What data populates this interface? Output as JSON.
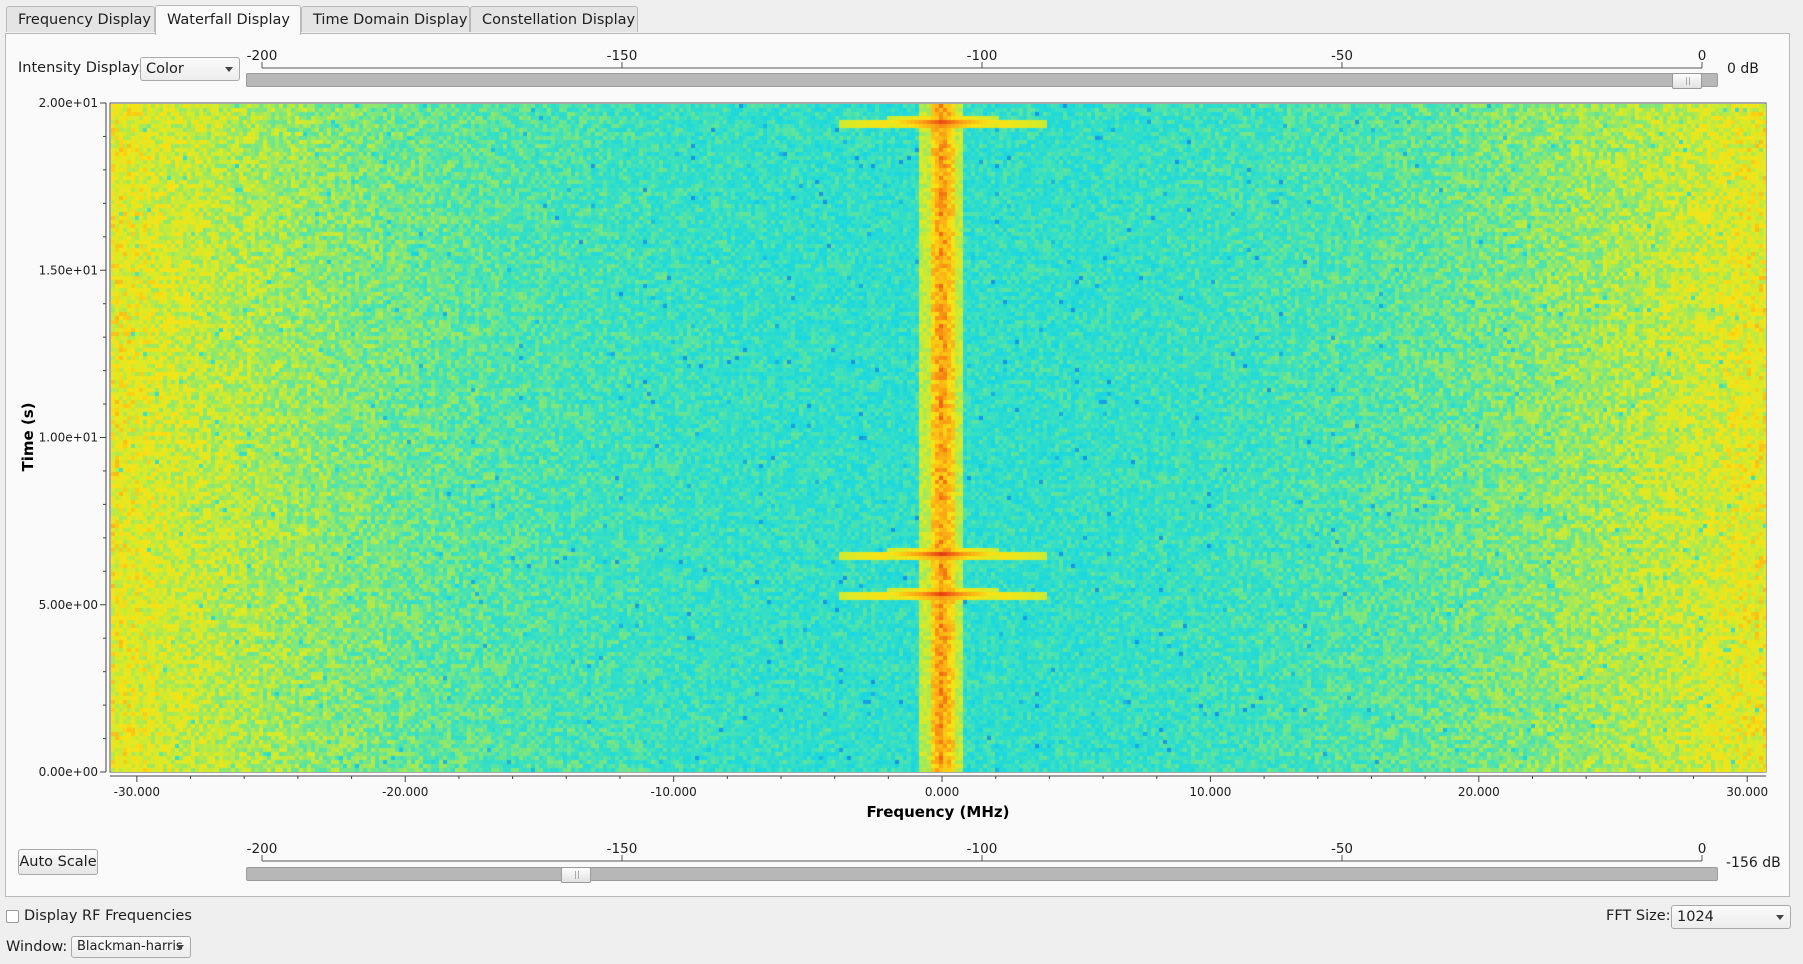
{
  "tabs": [
    {
      "label": "Frequency Display"
    },
    {
      "label": "Waterfall Display"
    },
    {
      "label": "Time Domain Display"
    },
    {
      "label": "Constellation Display"
    }
  ],
  "active_tab": "Waterfall Display",
  "intensity": {
    "label": "Intensity Display:",
    "value": "Color"
  },
  "top_slider": {
    "ticks": [
      "-200",
      "-150",
      "-100",
      "-50",
      "0"
    ],
    "value_label": "0 dB",
    "value_db": 0,
    "range": [
      -200,
      0
    ]
  },
  "bottom_slider": {
    "ticks": [
      "-200",
      "-150",
      "-100",
      "-50",
      "0"
    ],
    "value_label": "-156 dB",
    "value_db": -156,
    "range": [
      -200,
      0
    ]
  },
  "auto_scale_label": "Auto Scale",
  "display_rf": {
    "label": "Display RF Frequencies",
    "checked": false
  },
  "fft": {
    "label": "FFT Size:",
    "value": "1024"
  },
  "window": {
    "label": "Window:",
    "value": "Blackman-harris"
  },
  "colors": {
    "accent_low": "#1ad8e0",
    "accent_high": "#f5e31c",
    "signal": "#e8241a"
  },
  "chart_data": {
    "type": "heatmap",
    "xlabel": "Frequency (MHz)",
    "ylabel": "Time (s)",
    "x_ticks": [
      "-30.000",
      "-20.000",
      "-10.000",
      "0.000",
      "10.000",
      "20.000",
      "30.000"
    ],
    "x_tick_values": [
      -30,
      -20,
      -10,
      0,
      10,
      20,
      30
    ],
    "y_ticks": [
      "0.00e+00",
      "5.00e+00",
      "1.00e+01",
      "1.50e+01",
      "2.00e+01"
    ],
    "y_tick_values": [
      0,
      5,
      10,
      15,
      20
    ],
    "xlim": [
      -31,
      30.7
    ],
    "ylim": [
      0,
      20
    ],
    "signal_center_mhz": 0,
    "bursts_s": [
      19.4,
      6.5,
      5.3
    ]
  }
}
